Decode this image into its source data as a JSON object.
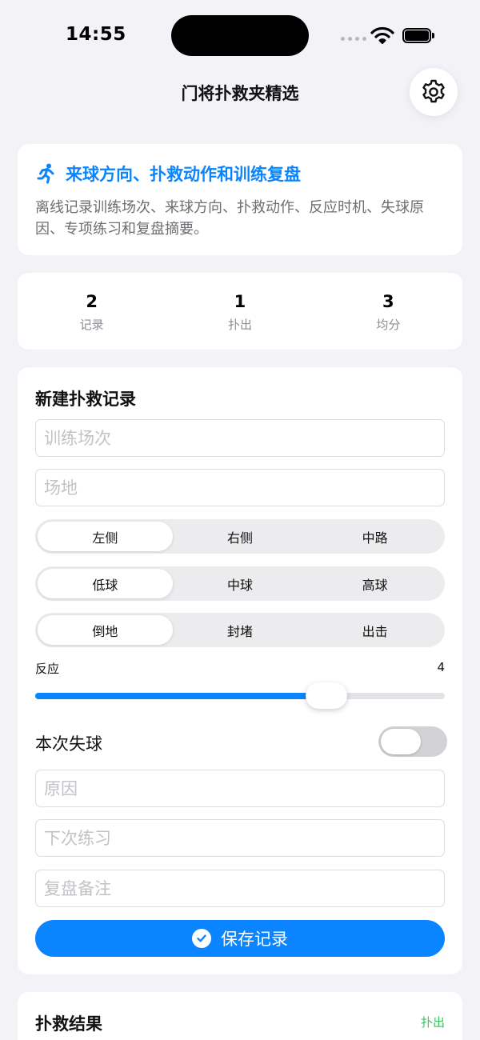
{
  "status_bar": {
    "time": "14:55"
  },
  "nav": {
    "title": "门将扑救夹精选",
    "settings_icon": "gear-icon"
  },
  "hero": {
    "icon": "running-person-icon",
    "title": "来球方向、扑救动作和训练复盘",
    "description": "离线记录训练场次、来球方向、扑救动作、反应时机、失球原因、专项练习和复盘摘要。",
    "accent_color": "#0a84ff"
  },
  "stats": [
    {
      "value": "2",
      "label": "记录"
    },
    {
      "value": "1",
      "label": "扑出"
    },
    {
      "value": "3",
      "label": "均分"
    }
  ],
  "form": {
    "title": "新建扑救记录",
    "session_placeholder": "训练场次",
    "venue_placeholder": "场地",
    "direction": {
      "options": [
        "左侧",
        "右侧",
        "中路"
      ],
      "selected": "左侧"
    },
    "height": {
      "options": [
        "低球",
        "中球",
        "高球"
      ],
      "selected": "低球"
    },
    "action": {
      "options": [
        "倒地",
        "封堵",
        "出击"
      ],
      "selected": "倒地"
    },
    "reaction": {
      "label": "反应",
      "value": "4",
      "fraction": 0.71
    },
    "conceded": {
      "label": "本次失球",
      "on": false
    },
    "reason_placeholder": "原因",
    "next_practice_placeholder": "下次练习",
    "review_placeholder": "复盘备注",
    "save_label": "保存记录"
  },
  "result": {
    "title": "扑救结果",
    "badge": "扑出",
    "badge_color": "#34c759"
  }
}
